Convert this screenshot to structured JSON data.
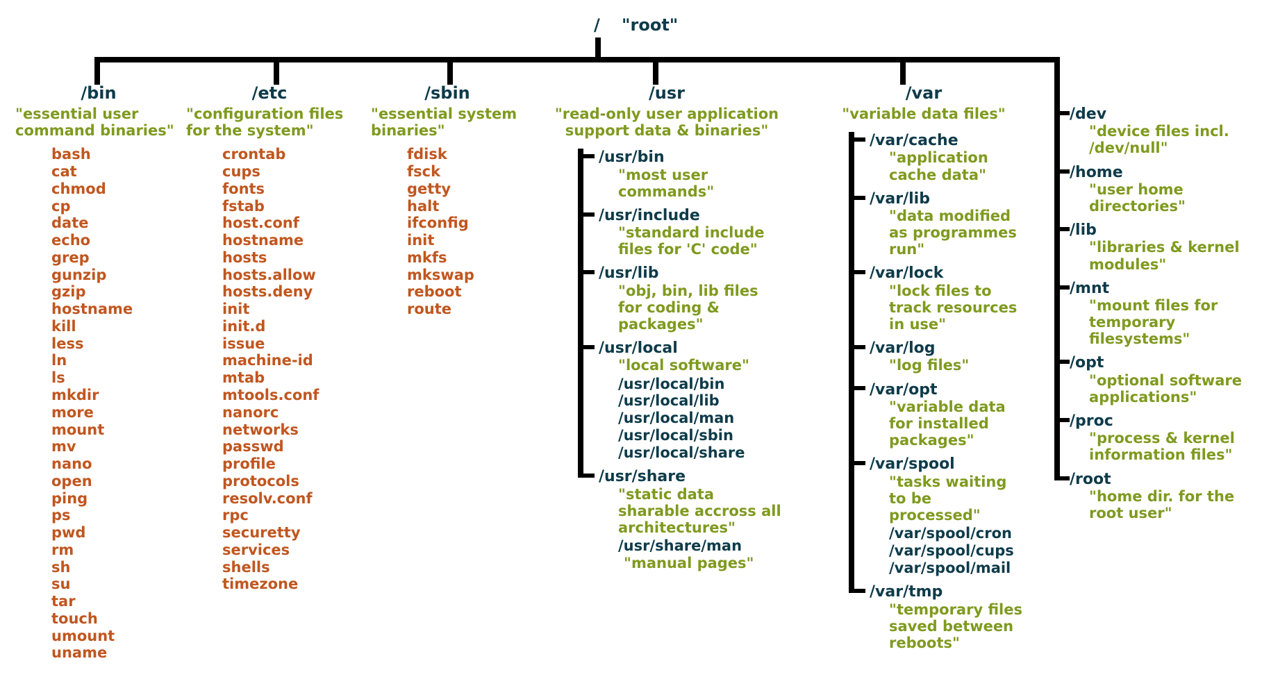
{
  "root": {
    "slash": "/",
    "desc": "\"root\""
  },
  "cols": {
    "bin": {
      "title": "/bin",
      "desc": "\"essential user command binaries\"",
      "items": [
        "bash",
        "cat",
        "chmod",
        "cp",
        "date",
        "echo",
        "grep",
        "gunzip",
        "gzip",
        "hostname",
        "kill",
        "less",
        "ln",
        "ls",
        "mkdir",
        "more",
        "mount",
        "mv",
        "nano",
        "open",
        "ping",
        "ps",
        "pwd",
        "rm",
        "sh",
        "su",
        "tar",
        "touch",
        "umount",
        "uname"
      ]
    },
    "etc": {
      "title": "/etc",
      "desc": "\"configuration files for the system\"",
      "items": [
        "crontab",
        "cups",
        "fonts",
        "fstab",
        "host.conf",
        "hostname",
        "hosts",
        "hosts.allow",
        "hosts.deny",
        "init",
        "init.d",
        "issue",
        "machine-id",
        "mtab",
        "mtools.conf",
        "nanorc",
        "networks",
        "passwd",
        "profile",
        "protocols",
        "resolv.conf",
        "rpc",
        "securetty",
        "services",
        "shells",
        "timezone"
      ]
    },
    "sbin": {
      "title": "/sbin",
      "desc": "\"essential system binaries\"",
      "items": [
        "fdisk",
        "fsck",
        "getty",
        "halt",
        "ifconfig",
        "init",
        "mkfs",
        "mkswap",
        "reboot",
        "route"
      ]
    },
    "usr": {
      "title": "/usr",
      "desc": "\"read-only user application support data & binaries\"",
      "subs": [
        {
          "name": "/usr/bin",
          "desc": "\"most user commands\""
        },
        {
          "name": "/usr/include",
          "desc": "\"standard include files for 'C' code\""
        },
        {
          "name": "/usr/lib",
          "desc": "\"obj, bin, lib files for coding & packages\""
        },
        {
          "name": "/usr/local",
          "desc": "\"local software\"",
          "subs": [
            "/usr/local/bin",
            "/usr/local/lib",
            "/usr/local/man",
            "/usr/local/sbin",
            "/usr/local/share"
          ]
        },
        {
          "name": "/usr/share",
          "desc": "\"static data sharable accross all architectures\"",
          "subs": [
            "/usr/share/man"
          ],
          "subdesc": "\"manual pages\""
        }
      ]
    },
    "var": {
      "title": "/var",
      "desc": "\"variable data files\"",
      "subs": [
        {
          "name": "/var/cache",
          "desc": "\"application cache data\""
        },
        {
          "name": "/var/lib",
          "desc": "\"data modified as programmes run\""
        },
        {
          "name": "/var/lock",
          "desc": "\"lock files to track resources in use\""
        },
        {
          "name": "/var/log",
          "desc": "\"log files\""
        },
        {
          "name": "/var/opt",
          "desc": "\"variable data for installed packages\""
        },
        {
          "name": "/var/spool",
          "desc": "\"tasks waiting to be processed\"",
          "subs": [
            "/var/spool/cron",
            "/var/spool/cups",
            "/var/spool/mail"
          ]
        },
        {
          "name": "/var/tmp",
          "desc": "\"temporary files saved between reboots\""
        }
      ]
    },
    "right": {
      "subs": [
        {
          "name": "/dev",
          "desc": "\"device files incl. /dev/null\""
        },
        {
          "name": "/home",
          "desc": "\"user home directories\""
        },
        {
          "name": "/lib",
          "desc": "\"libraries & kernel modules\""
        },
        {
          "name": "/mnt",
          "desc": "\"mount files for temporary filesystems\""
        },
        {
          "name": "/opt",
          "desc": "\"optional software applications\""
        },
        {
          "name": "/proc",
          "desc": "\"process & kernel information files\""
        },
        {
          "name": "/root",
          "desc": "\"home dir. for the root user\""
        }
      ]
    }
  }
}
